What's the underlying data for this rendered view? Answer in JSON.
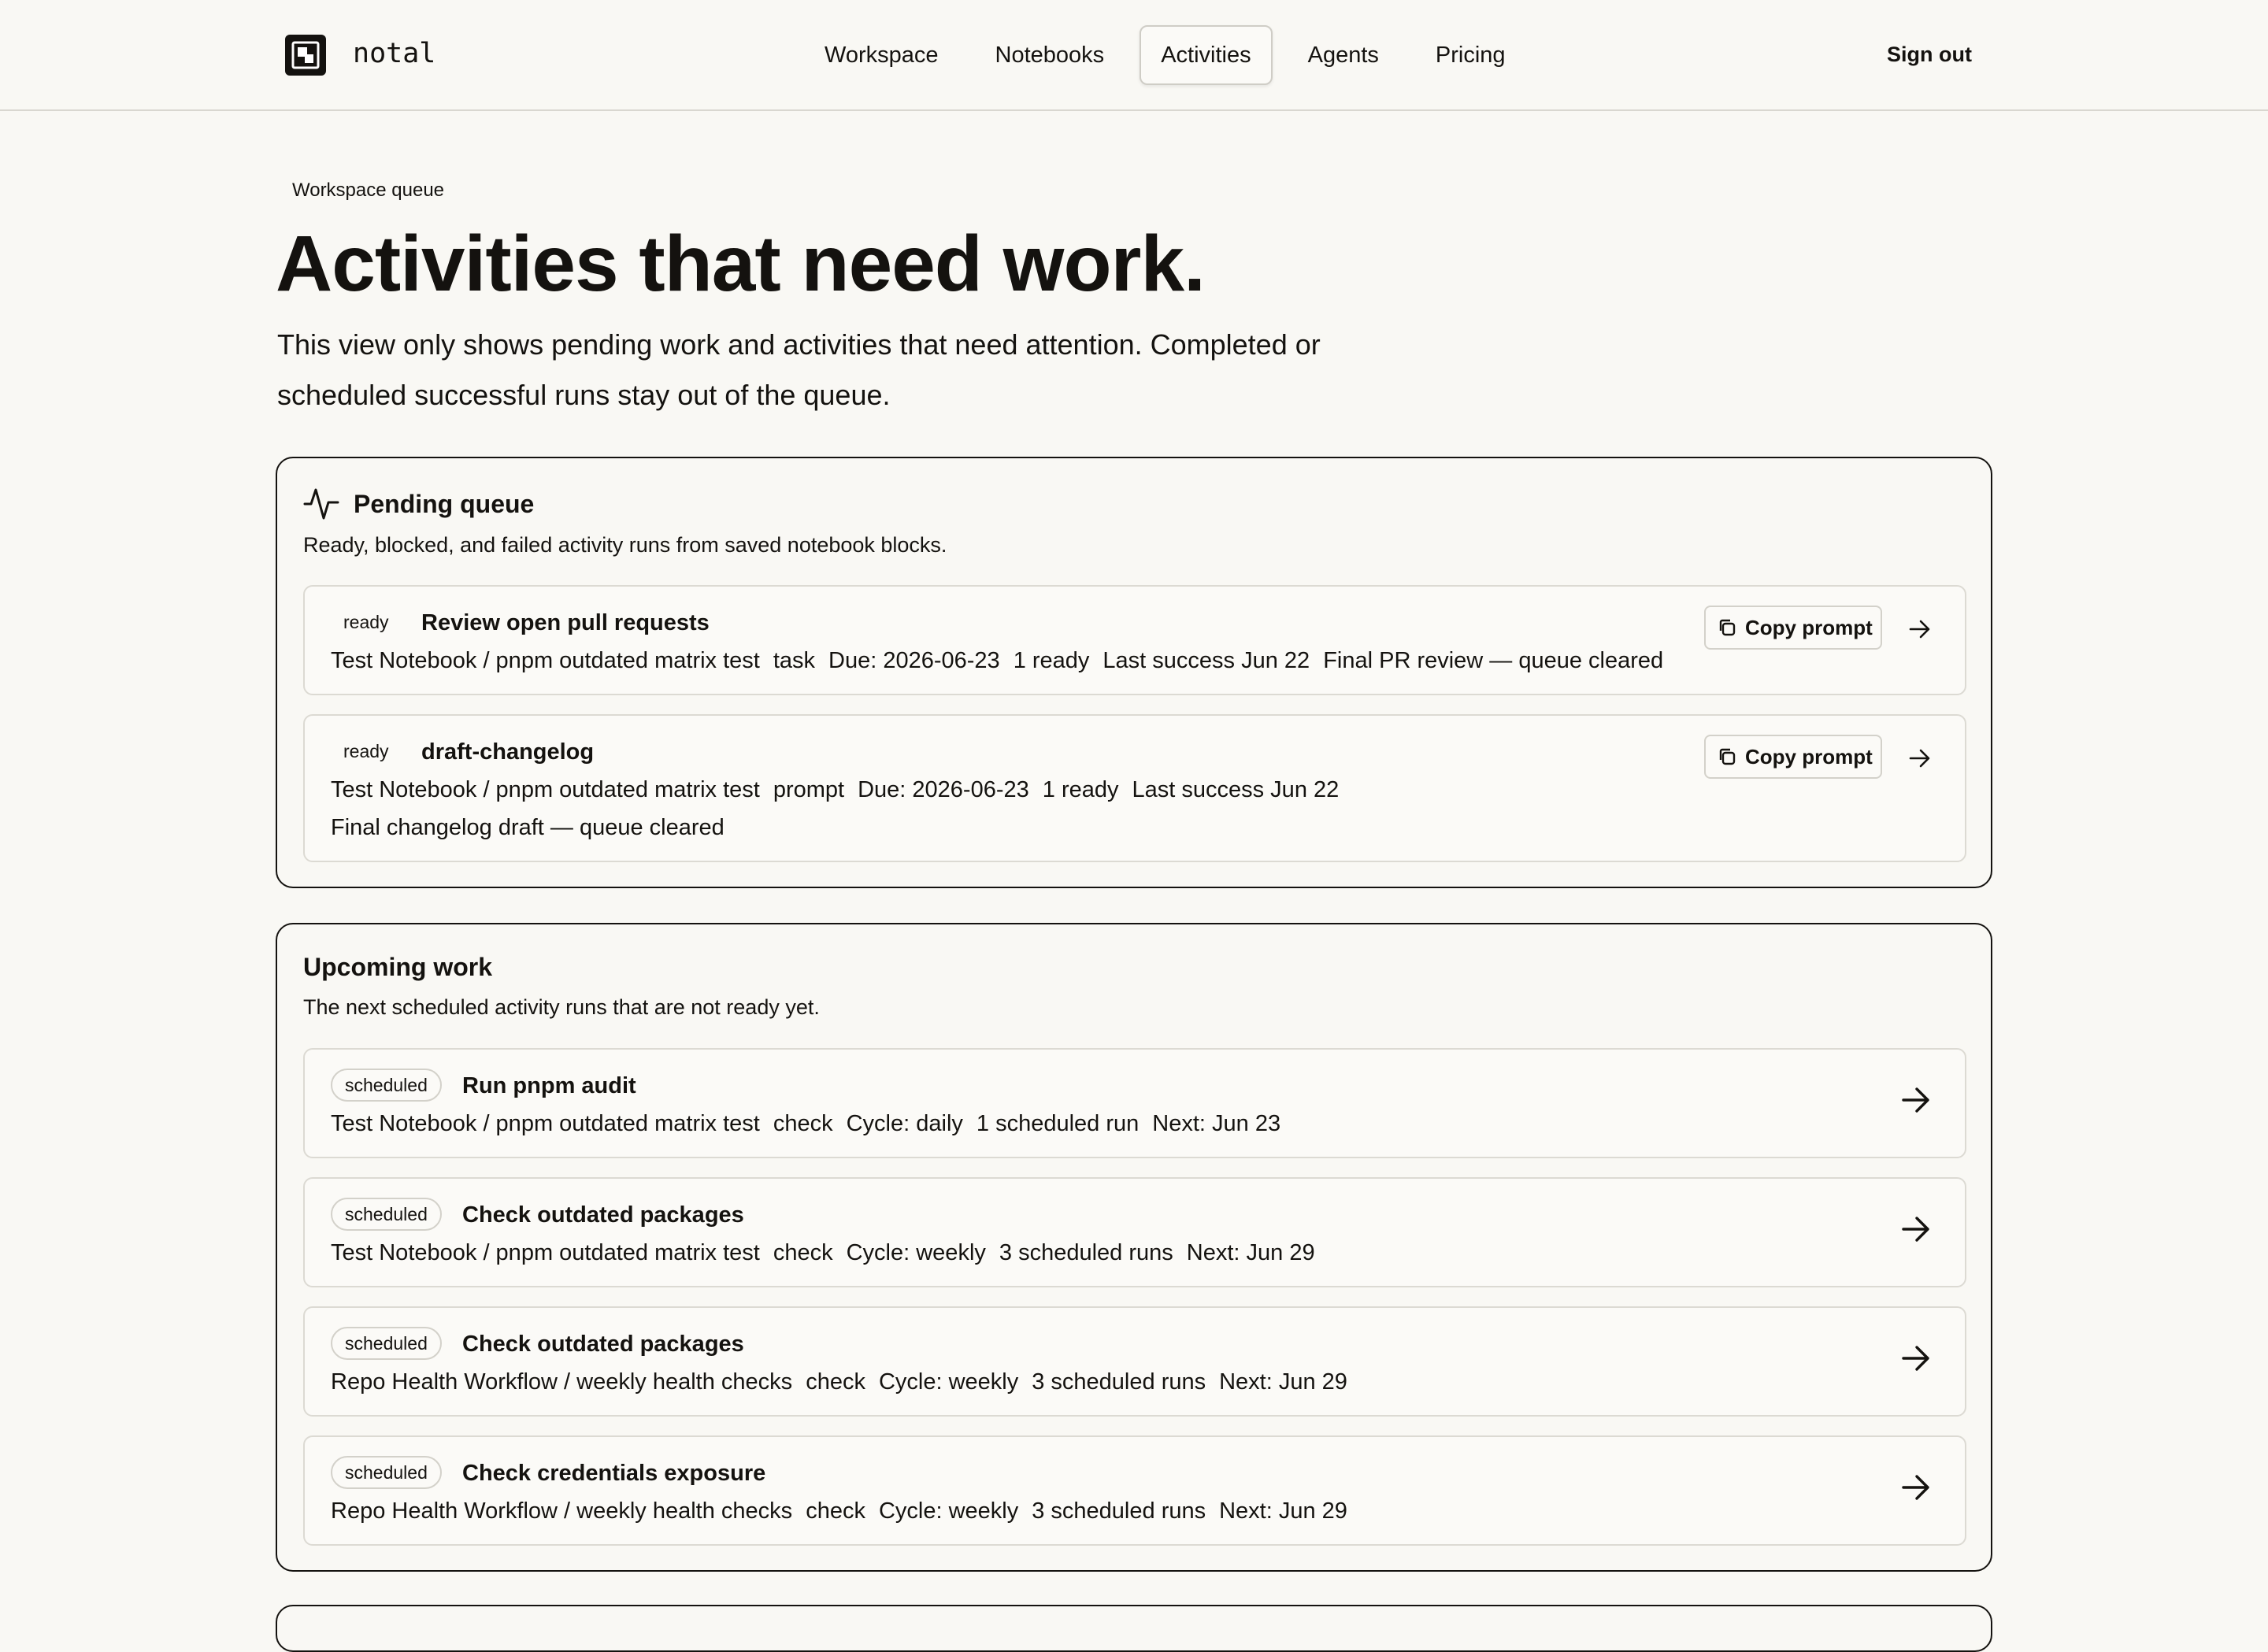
{
  "header": {
    "logo_text": "notal",
    "nav": [
      {
        "label": "Workspace",
        "active": false
      },
      {
        "label": "Notebooks",
        "active": false
      },
      {
        "label": "Activities",
        "active": true
      },
      {
        "label": "Agents",
        "active": false
      },
      {
        "label": "Pricing",
        "active": false
      }
    ],
    "sign_out": "Sign out"
  },
  "hero": {
    "eyebrow": "Workspace queue",
    "title": "Activities that need work.",
    "lead": "This view only shows pending work and activities that need attention. Completed or scheduled successful runs stay out of the queue."
  },
  "pending": {
    "title": "Pending queue",
    "subtitle": "Ready, blocked, and failed activity runs from saved notebook blocks.",
    "copy_label": "Copy prompt",
    "rows": [
      {
        "status": "ready",
        "title": "Review open pull requests",
        "meta": [
          "Test Notebook / pnpm outdated matrix test",
          "task",
          "Due: 2026-06-23",
          "1 ready",
          "Last success Jun 22",
          "Final PR review — queue cleared"
        ],
        "extra": ""
      },
      {
        "status": "ready",
        "title": "draft-changelog",
        "meta": [
          "Test Notebook / pnpm outdated matrix test",
          "prompt",
          "Due: 2026-06-23",
          "1 ready",
          "Last success Jun 22"
        ],
        "extra": "Final changelog draft — queue cleared"
      }
    ]
  },
  "upcoming": {
    "title": "Upcoming work",
    "subtitle": "The next scheduled activity runs that are not ready yet.",
    "rows": [
      {
        "status": "scheduled",
        "title": "Run pnpm audit",
        "meta": [
          "Test Notebook / pnpm outdated matrix test",
          "check",
          "Cycle: daily",
          "1 scheduled run",
          "Next: Jun 23"
        ]
      },
      {
        "status": "scheduled",
        "title": "Check outdated packages",
        "meta": [
          "Test Notebook / pnpm outdated matrix test",
          "check",
          "Cycle: weekly",
          "3 scheduled runs",
          "Next: Jun 29"
        ]
      },
      {
        "status": "scheduled",
        "title": "Check outdated packages",
        "meta": [
          "Repo Health Workflow / weekly health checks",
          "check",
          "Cycle: weekly",
          "3 scheduled runs",
          "Next: Jun 29"
        ]
      },
      {
        "status": "scheduled",
        "title": "Check credentials exposure",
        "meta": [
          "Repo Health Workflow / weekly health checks",
          "check",
          "Cycle: weekly",
          "3 scheduled runs",
          "Next: Jun 29"
        ]
      }
    ]
  }
}
